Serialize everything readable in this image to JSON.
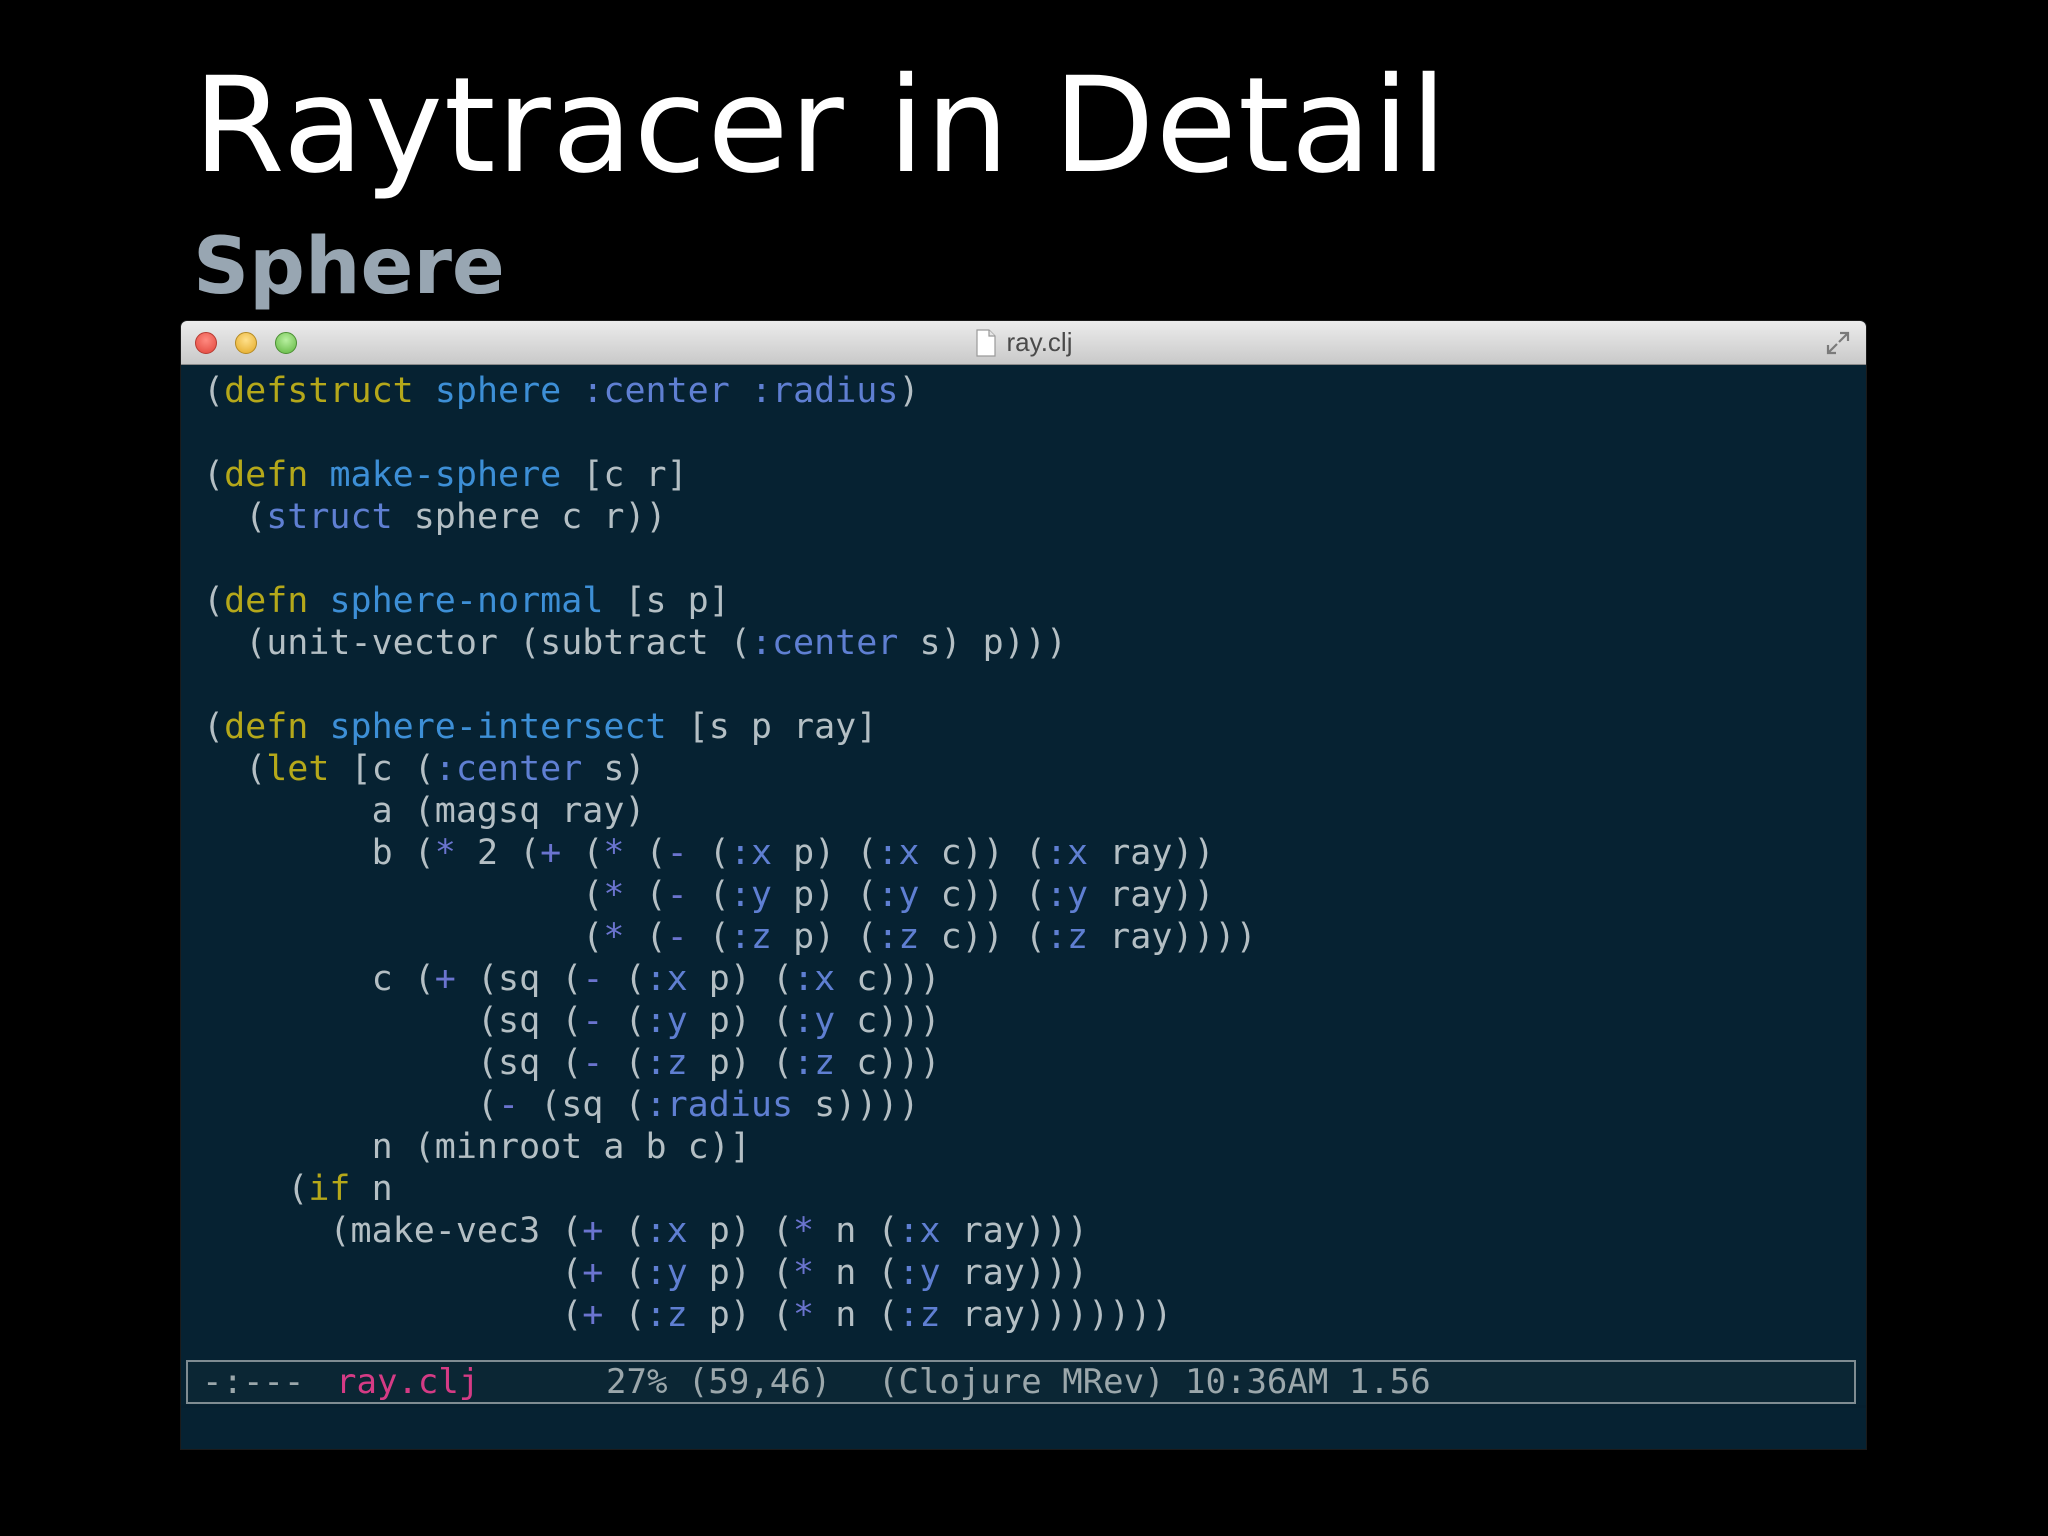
{
  "slide": {
    "title": "Raytracer in Detail",
    "subtitle": "Sphere"
  },
  "window": {
    "title": "ray.clj"
  },
  "code": {
    "lines": [
      [
        [
          "(",
          "p"
        ],
        [
          "defstruct",
          "kw"
        ],
        [
          " ",
          "p"
        ],
        [
          "sphere",
          "fn"
        ],
        [
          " ",
          "p"
        ],
        [
          ":center",
          "kwd"
        ],
        [
          " ",
          "p"
        ],
        [
          ":radius",
          "kwd"
        ],
        [
          ")",
          "p"
        ]
      ],
      [],
      [
        [
          "(",
          "p"
        ],
        [
          "defn",
          "kw"
        ],
        [
          " ",
          "p"
        ],
        [
          "make-sphere",
          "fn"
        ],
        [
          " [c r]",
          "p"
        ]
      ],
      [
        [
          "  (",
          "p"
        ],
        [
          "struct",
          "kwd"
        ],
        [
          " sphere c r))",
          "p"
        ]
      ],
      [],
      [
        [
          "(",
          "p"
        ],
        [
          "defn",
          "kw"
        ],
        [
          " ",
          "p"
        ],
        [
          "sphere-normal",
          "fn"
        ],
        [
          " [s p]",
          "p"
        ]
      ],
      [
        [
          "  (unit-vector (subtract (",
          "p"
        ],
        [
          ":center",
          "kwd"
        ],
        [
          " s) p)))",
          "p"
        ]
      ],
      [],
      [
        [
          "(",
          "p"
        ],
        [
          "defn",
          "kw"
        ],
        [
          " ",
          "p"
        ],
        [
          "sphere-intersect",
          "fn"
        ],
        [
          " [s p ray]",
          "p"
        ]
      ],
      [
        [
          "  (",
          "p"
        ],
        [
          "let",
          "kw"
        ],
        [
          " [c (",
          "p"
        ],
        [
          ":center",
          "kwd"
        ],
        [
          " s)",
          "p"
        ]
      ],
      [
        [
          "        a (magsq ray)",
          "p"
        ]
      ],
      [
        [
          "        b (",
          "p"
        ],
        [
          "*",
          "op"
        ],
        [
          " 2 (",
          "p"
        ],
        [
          "+",
          "op"
        ],
        [
          " (",
          "p"
        ],
        [
          "*",
          "op"
        ],
        [
          " (",
          "p"
        ],
        [
          "-",
          "op"
        ],
        [
          " (",
          "p"
        ],
        [
          ":x",
          "kwd"
        ],
        [
          " p) (",
          "p"
        ],
        [
          ":x",
          "kwd"
        ],
        [
          " c)) (",
          "p"
        ],
        [
          ":x",
          "kwd"
        ],
        [
          " ray))",
          "p"
        ]
      ],
      [
        [
          "                  (",
          "p"
        ],
        [
          "*",
          "op"
        ],
        [
          " (",
          "p"
        ],
        [
          "-",
          "op"
        ],
        [
          " (",
          "p"
        ],
        [
          ":y",
          "kwd"
        ],
        [
          " p) (",
          "p"
        ],
        [
          ":y",
          "kwd"
        ],
        [
          " c)) (",
          "p"
        ],
        [
          ":y",
          "kwd"
        ],
        [
          " ray))",
          "p"
        ]
      ],
      [
        [
          "                  (",
          "p"
        ],
        [
          "*",
          "op"
        ],
        [
          " (",
          "p"
        ],
        [
          "-",
          "op"
        ],
        [
          " (",
          "p"
        ],
        [
          ":z",
          "kwd"
        ],
        [
          " p) (",
          "p"
        ],
        [
          ":z",
          "kwd"
        ],
        [
          " c)) (",
          "p"
        ],
        [
          ":z",
          "kwd"
        ],
        [
          " ray))))",
          "p"
        ]
      ],
      [
        [
          "        c (",
          "p"
        ],
        [
          "+",
          "op"
        ],
        [
          " (sq (",
          "p"
        ],
        [
          "-",
          "op"
        ],
        [
          " (",
          "p"
        ],
        [
          ":x",
          "kwd"
        ],
        [
          " p) (",
          "p"
        ],
        [
          ":x",
          "kwd"
        ],
        [
          " c)))",
          "p"
        ]
      ],
      [
        [
          "             (sq (",
          "p"
        ],
        [
          "-",
          "op"
        ],
        [
          " (",
          "p"
        ],
        [
          ":y",
          "kwd"
        ],
        [
          " p) (",
          "p"
        ],
        [
          ":y",
          "kwd"
        ],
        [
          " c)))",
          "p"
        ]
      ],
      [
        [
          "             (sq (",
          "p"
        ],
        [
          "-",
          "op"
        ],
        [
          " (",
          "p"
        ],
        [
          ":z",
          "kwd"
        ],
        [
          " p) (",
          "p"
        ],
        [
          ":z",
          "kwd"
        ],
        [
          " c)))",
          "p"
        ]
      ],
      [
        [
          "             (",
          "p"
        ],
        [
          "-",
          "op"
        ],
        [
          " (sq (",
          "p"
        ],
        [
          ":radius",
          "kwd"
        ],
        [
          " s))))",
          "p"
        ]
      ],
      [
        [
          "        n (minroot a b c)]",
          "p"
        ]
      ],
      [
        [
          "    (",
          "p"
        ],
        [
          "if",
          "kw"
        ],
        [
          " n",
          "p"
        ]
      ],
      [
        [
          "      (make-vec3 (",
          "p"
        ],
        [
          "+",
          "op"
        ],
        [
          " (",
          "p"
        ],
        [
          ":x",
          "kwd"
        ],
        [
          " p) (",
          "p"
        ],
        [
          "*",
          "op"
        ],
        [
          " n (",
          "p"
        ],
        [
          ":x",
          "kwd"
        ],
        [
          " ray)))",
          "p"
        ]
      ],
      [
        [
          "                 (",
          "p"
        ],
        [
          "+",
          "op"
        ],
        [
          " (",
          "p"
        ],
        [
          ":y",
          "kwd"
        ],
        [
          " p) (",
          "p"
        ],
        [
          "*",
          "op"
        ],
        [
          " n (",
          "p"
        ],
        [
          ":y",
          "kwd"
        ],
        [
          " ray)))",
          "p"
        ]
      ],
      [
        [
          "                 (",
          "p"
        ],
        [
          "+",
          "op"
        ],
        [
          " (",
          "p"
        ],
        [
          ":z",
          "kwd"
        ],
        [
          " p) (",
          "p"
        ],
        [
          "*",
          "op"
        ],
        [
          " n (",
          "p"
        ],
        [
          ":z",
          "kwd"
        ],
        [
          " ray)))))))",
          "p"
        ]
      ]
    ]
  },
  "modeline": {
    "flags": "-:---",
    "buffer": "ray.clj",
    "position": "27% (59,46)",
    "mode": "(Clojure MRev) 10:36AM 1.56"
  },
  "colors": {
    "background": "#000000",
    "editor_bg": "#062232",
    "keyword": "#b5a81a",
    "function_name": "#3d8fd6",
    "keyword_literal": "#5f7fd2",
    "buffer_name": "#d53b85"
  },
  "icons": {
    "close": "close-icon",
    "minimize": "minimize-icon",
    "zoom": "zoom-icon",
    "document": "document-icon",
    "fullscreen": "fullscreen-icon"
  }
}
